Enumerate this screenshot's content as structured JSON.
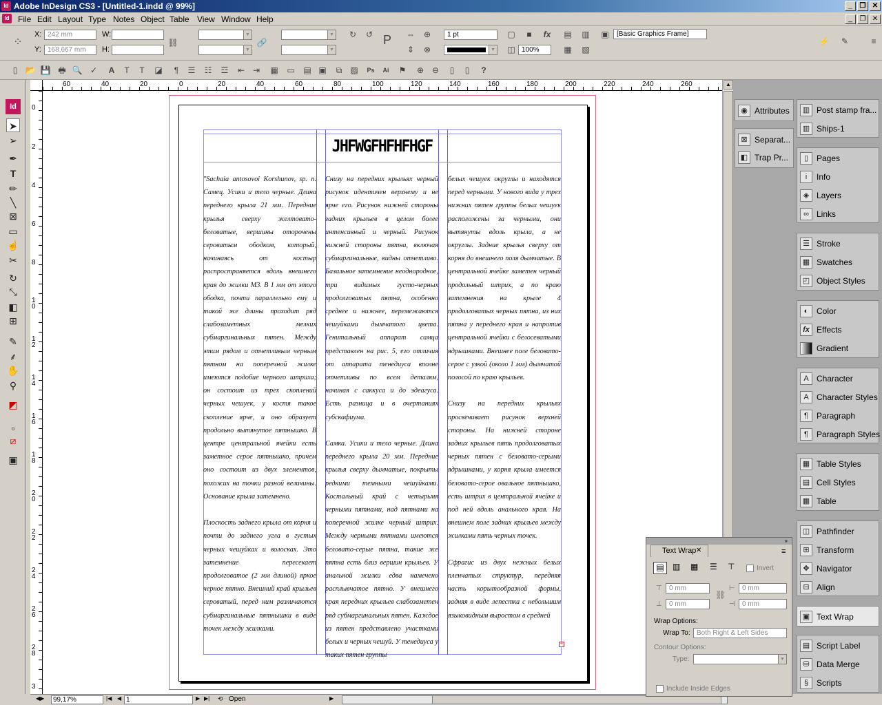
{
  "window": {
    "title": "Adobe InDesign CS3 - [Untitled-1.indd @ 99%]",
    "app_icon": "Id"
  },
  "menu": [
    "File",
    "Edit",
    "Layout",
    "Type",
    "Notes",
    "Object",
    "Table",
    "View",
    "Window",
    "Help"
  ],
  "control": {
    "x_label": "X:",
    "x_value": "242 mm",
    "y_label": "Y:",
    "y_value": "168,667 mm",
    "w_label": "W:",
    "h_label": "H:",
    "stroke_weight": "1 pt",
    "opacity": "100%",
    "object_style": "[Basic Graphics Frame]"
  },
  "ruler_top": [
    "60",
    "40",
    "20",
    "0",
    "20",
    "40",
    "60",
    "80",
    "100",
    "120",
    "140",
    "160",
    "180",
    "200",
    "220",
    "240",
    "260"
  ],
  "ruler_left": [
    "0",
    "2",
    "4",
    "6",
    "8",
    "1 0",
    "1 2",
    "1 4",
    "1 6",
    "1 8",
    "2 0",
    "2 2",
    "2 4",
    "2 6",
    "2 8",
    "3"
  ],
  "document": {
    "heading": "JHFWGFHFHFHGF",
    "col1": [
      "\"Sachaia antosovoi Korshunov, sp. n. Самец. Усики и тело черные. Длина переднего крыла 21 мм. Передние крылья сверху желтовато-беловатые, вершины оторочены сероватым ободком, который, начинаясь от костыр распространяется вдоль внешнего края до жилки М3. В 1 мм от этого ободка, почти параллельно ему и такой же длины проходит ряд слабозаметных мелких субмаргинальных пятен. Между этим рядом и отчетливым черным пятном на поперечной жилке имеются подобие черного штриха; он состоит из трех скоплений черных чешуек, у костя такое скопление ярче, и оно образует продольно вытянутое пятнышко. В центре центральной ячейки есть заметное серое пятнышко, причем оно состоит из двух элементов, похожих на точки разной величины. Основание крыла затемнено.",
      "Плоскость заднего крыла от корня и почти до заднего угла в густых черных чешуйках и волосках. Это затемнение пересекает продолговатое (2 мм длиной) яркое черное пятно. Внешний край крыльев сероватый, перед ним различаются субмаргинальные пятнышки в виде точек между жилками."
    ],
    "col2": [
      "Снизу на передних крыльях черный рисунок идентичен верхнему и не ярче его. Рисунок нижней стороны задних крыльев в целом более интенсивный и черный. Рисунок нижней стороны пятна, включая субмаргинальные, видны отчетливо. Базальное затемнение неоднородное, три видимых густо-черных продолговатых пятна, особенно среднее и нижнее, перемежаются чешуйками дымчатого цвета. Генитальный аппарат самца представлен на рис. 5, его отличия от аппарата тенедиуса вполне отчетливы по всем деталям, начиная с саккуса и до эдеагуса. Есть разница и в очертаниях субскафиума.",
      "Самка. Усики и тело черные. Длина переднего крыла 20 мм. Передние крылья сверху дымчатые, покрыты редкими темными чешуйками. Костальный край с четырьмя черными пятнами, над пятнами на поперечной жилке черный штрих. Между черными пятнами имеются беловато-серые пятна, такие же пятна есть близ вершин крыльев. У анальной жилки едва намечено расплывчатое пятно. У внешнего края передних крыльев слабозаметен ряд субмаргинальных пятен. Каждое из пятен представлено участками белых и черных чешуй. У тенедиуса у таких пятен группы"
    ],
    "col3": [
      "белых чешуек округлы и находятся перед черными. У нового вида у трех нижних пятен группы белых чешуек расположены за черными, они вытянуты вдоль крыла, а не округлы. Задние крылья сверху от корня до внешнего поля дымчатые. В центральной ячейке заметен черный продольный штрих, а по краю затемнения на крыле 4 продолговатых черных пятна, из них пятна у переднего края и напротив центральной ячейки с белосеватыми ядрышками. Внешнее поле беловато-серое с узкой (около 1 мм) дымчатой полосой по краю крыльев.",
      "Снизу на передних крыльях просвечивает рисунок верхней стороны. На нижней стороне задних крыльев пять продолговатых черных пятен с беловато-серыми ядрышками, у корня крыла имеется беловато-серое овальное пятнышко, есть штрих в центральной ячейке и под ней вдоль анального края. На внешнем поле задних крыльев между жилками пять черных точек.",
      "Сфрагис из двух нежных белых пленчатых структур, передняя часть корытообразной формы, задняя в виде лепестка с небольшим языковидным выростом в средней"
    ]
  },
  "status": {
    "zoom": "99,17%",
    "page": "1",
    "state": "Open"
  },
  "dock_left": [
    "Attributes",
    "Separat...",
    "Trap Pr..."
  ],
  "dock_right": [
    [
      "Post stamp fra...",
      "Ships-1"
    ],
    [
      "Pages",
      "Info",
      "Layers",
      "Links"
    ],
    [
      "Stroke",
      "Swatches",
      "Object Styles"
    ],
    [
      "Color",
      "Effects",
      "Gradient"
    ],
    [
      "Character",
      "Character Styles",
      "Paragraph",
      "Paragraph Styles"
    ],
    [
      "Table Styles",
      "Cell Styles",
      "Table"
    ],
    [
      "Pathfinder",
      "Transform",
      "Navigator",
      "Align"
    ],
    [
      "Text Wrap"
    ],
    [
      "Script Label",
      "Data Merge",
      "Scripts"
    ]
  ],
  "text_wrap": {
    "title": "Text Wrap",
    "invert": "Invert",
    "field_value": "0 mm",
    "wrap_options": "Wrap Options:",
    "wrap_to_label": "Wrap To:",
    "wrap_to_value": "Both Right & Left Sides",
    "contour_options": "Contour Options:",
    "type_label": "Type:",
    "include_inside": "Include Inside Edges"
  }
}
